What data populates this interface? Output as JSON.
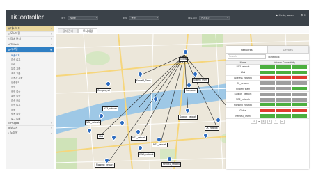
{
  "app": {
    "logo": "TiController",
    "selectors": [
      {
        "label": "조직",
        "value": "None"
      },
      {
        "label": "조직",
        "value": "폭증"
      },
      {
        "label": "네트워크",
        "value": "전체보기"
      }
    ],
    "user": "▲ Hello, super",
    "header_icons": "⚙ ✕"
  },
  "sidebar": {
    "items": [
      {
        "icon": "▦",
        "label": "대시보드"
      },
      {
        "icon": "◎",
        "label": "모니터링"
      },
      {
        "icon": "✎",
        "label": "장애 관리"
      },
      {
        "icon": "⇄",
        "label": "TIMesh"
      },
      {
        "icon": "⚙",
        "label": "시스템"
      }
    ],
    "sub_items": [
      "토폴로지",
      "접속 로그",
      "이력",
      "분류 그룹",
      "조직 그룹",
      "사용자 그룹",
      "인증정보",
      "정책",
      "정책 접속",
      "통합 접속",
      "접속 관리",
      "접속 로그",
      "제품",
      "활용 요약",
      "로그 트레"
    ],
    "bottom_items": [
      {
        "icon": "⊞",
        "label": "Plugins"
      },
      {
        "icon": "▤",
        "label": "보고서"
      },
      {
        "icon": "?",
        "label": "도움말"
      }
    ]
  },
  "tabs": [
    "공지 관리",
    "모니터링"
  ],
  "map": {
    "labels": [
      {
        "text": "Global",
        "id": "global"
      },
      {
        "text": "Kernel3_Team",
        "id": "kernel3"
      },
      {
        "text": "System_team",
        "id": "system-team"
      },
      {
        "text": "Campuses",
        "id": "campuses"
      },
      {
        "text": "Campus_net",
        "id": "campus-net"
      },
      {
        "text": "NX3_network",
        "id": "nx3"
      },
      {
        "text": "Support_network",
        "id": "support"
      },
      {
        "text": "NS2_network",
        "id": "ns2"
      },
      {
        "text": "JK_network",
        "id": "jk"
      },
      {
        "text": "LAN",
        "id": "lan"
      },
      {
        "text": "NS3_network",
        "id": "ns3"
      },
      {
        "text": "NS2_network",
        "id": "ns2b"
      },
      {
        "text": "Planning_network",
        "id": "planning"
      },
      {
        "text": "WNA_network",
        "id": "wna"
      },
      {
        "text": "Wireless_network",
        "id": "wireless"
      },
      {
        "text": "Kernel4_network",
        "id": "kernel4"
      }
    ]
  },
  "panel": {
    "tabs": [
      "Networks",
      "Devices"
    ],
    "search_placeholder": "Search",
    "count": "46 network",
    "columns": [
      "Name",
      "Network Connectivity"
    ],
    "rows": [
      {
        "name": "NS3 network",
        "status": [
          "#4caf3f",
          "#4caf3f",
          "#4caf3f"
        ]
      },
      {
        "name": "LAN",
        "status": [
          "#4caf3f",
          "#4caf3f",
          "#4caf3f"
        ]
      },
      {
        "name": "Wireless_network",
        "status": [
          "#e03b30",
          "#e03b30",
          "#e03b30"
        ]
      },
      {
        "name": "JK_network",
        "status": [
          "#9e9e9e",
          "#9e9e9e",
          "#9e9e9e"
        ]
      },
      {
        "name": "System_team",
        "status": [
          "#9e9e9e",
          "#9e9e9e",
          "#4caf3f"
        ]
      },
      {
        "name": "Support_network",
        "status": [
          "#9e9e9e",
          "#9e9e9e",
          "#9e9e9e"
        ]
      },
      {
        "name": "NS2_network",
        "status": [
          "#9e9e9e",
          "#9e9e9e",
          "#9e9e9e"
        ]
      },
      {
        "name": "Planning_network",
        "status": [
          "#4caf3f",
          "#4caf3f",
          "#4caf3f"
        ]
      },
      {
        "name": "Global",
        "status": [
          "#e03b30",
          "#e03b30",
          "#e03b30"
        ]
      },
      {
        "name": "Kernel3_Team",
        "status": [
          "#4caf3f",
          "#4caf3f",
          "#4caf3f"
        ]
      }
    ],
    "pager": [
      "10",
      "▾",
      "1",
      "2",
      "3",
      "»"
    ]
  }
}
